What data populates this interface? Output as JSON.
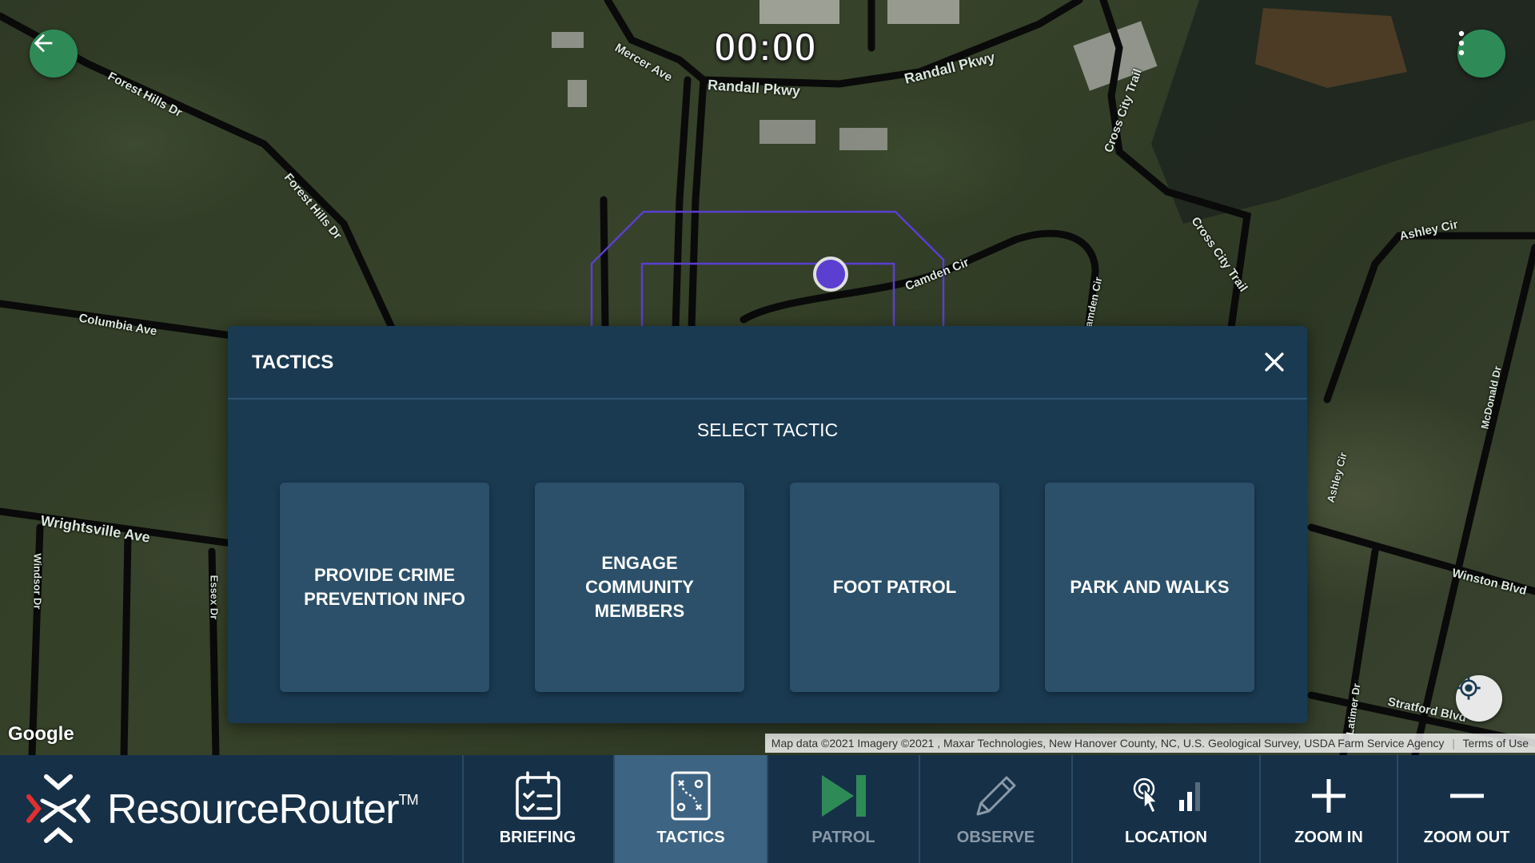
{
  "timer": "00:00",
  "map": {
    "road_labels": [
      "Forest Hills Dr",
      "Forest Hills Dr",
      "Mercer Ave",
      "Randall Pkwy",
      "Randall Pkwy",
      "Cross City Trail",
      "Columbia Ave",
      "Camden Cir",
      "Ashley Cir",
      "Wrightsville Ave",
      "Winston Blvd",
      "Stratford Blvd",
      "Windsor Dr",
      "Essex Dr",
      "McDonald Dr",
      "Latimer Dr",
      "Cross City Trail",
      "Ashley Cir",
      "Camden Cir"
    ],
    "google_logo": "Google",
    "attribution": "Map data ©2021 Imagery ©2021 , Maxar Technologies, New Hanover County, NC, U.S. Geological Survey, USDA Farm Service Agency",
    "terms": "Terms of Use"
  },
  "dialog": {
    "title": "TACTICS",
    "subtitle": "SELECT TACTIC",
    "tactics": [
      {
        "label": "PROVIDE CRIME PREVENTION INFO"
      },
      {
        "label": "ENGAGE COMMUNITY MEMBERS"
      },
      {
        "label": "FOOT PATROL"
      },
      {
        "label": "PARK AND WALKS"
      }
    ]
  },
  "bottom_bar": {
    "brand": "ResourceRouter",
    "trademark": "TM",
    "nav": [
      {
        "label": "BRIEFING",
        "icon": "checklist-icon"
      },
      {
        "label": "TACTICS",
        "icon": "playbook-icon",
        "active": true
      },
      {
        "label": "PATROL",
        "icon": "play-next-icon"
      },
      {
        "label": "OBSERVE",
        "icon": "pencil-icon"
      }
    ],
    "tools": {
      "location": "LOCATION",
      "zoom_in": "ZOOM IN",
      "zoom_out": "ZOOM OUT"
    }
  },
  "colors": {
    "dialog_bg": "#1a3a52",
    "card_bg": "#2c5069",
    "bar_bg": "#163048",
    "active_tab": "#3e6483",
    "accent_green": "#2e8b57",
    "geofence": "#5a3fd0"
  }
}
